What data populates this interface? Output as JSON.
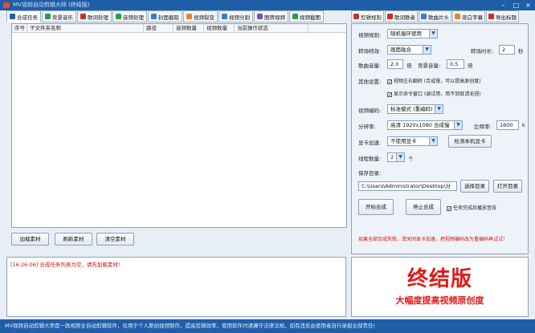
{
  "window": {
    "title": "MV视频自动剪辑大师 (终结版)"
  },
  "toolbar": {
    "tabs": [
      {
        "label": "合成任务",
        "icon": "play-icon",
        "color": "#1f5fa8"
      },
      {
        "label": "背景音乐",
        "icon": "music-icon",
        "color": "#2e9b4a"
      },
      {
        "label": "歌词处理",
        "icon": "lyrics-icon",
        "color": "#c8302a"
      },
      {
        "label": "音频处理",
        "icon": "audio-icon",
        "color": "#2e9b4a"
      },
      {
        "label": "封面截取",
        "icon": "cover-icon",
        "color": "#3a7bd5"
      },
      {
        "label": "视频裂变",
        "icon": "video-icon",
        "color": "#e08a1e"
      },
      {
        "label": "视频分割",
        "icon": "split-icon",
        "color": "#3a7bd5"
      },
      {
        "label": "图转视频",
        "icon": "image-icon",
        "color": "#7a4fc4"
      },
      {
        "label": "视频截图",
        "icon": "screenshot-icon",
        "color": "#2e9b4a"
      }
    ]
  },
  "table": {
    "columns": [
      "序号",
      "子文件夹名称",
      "路径",
      "音频数量",
      "视频数量",
      "当前操作状态"
    ]
  },
  "buttons": {
    "load": "加载素材",
    "refresh": "刷新素材",
    "clear": "清空素材"
  },
  "log": {
    "message": "[16:26:06] 合成任务列表为空，请先加载素材!"
  },
  "promo": {
    "title": "终结版",
    "subtitle": "大幅度提高视频原创度"
  },
  "right_tabs": [
    {
      "label": "剪辑规则",
      "icon": "rule-icon",
      "color": "#c8302a"
    },
    {
      "label": "歌词歌者",
      "icon": "lyrics-icon",
      "color": "#c8302a"
    },
    {
      "label": "歌曲片头",
      "icon": "intro-icon",
      "color": "#3a7bd5"
    },
    {
      "label": "旁白字幕",
      "icon": "subtitle-icon",
      "color": "#e08a1e"
    },
    {
      "label": "导出标题",
      "icon": "export-icon",
      "color": "#c8302a"
    }
  ],
  "settings": {
    "clip_rule_label": "视频规则:",
    "clip_rule_value": "随机循环使用",
    "transition_label": "转场特效:",
    "transition_value": "画面融合",
    "transition_duration_label": "转场时长:",
    "transition_duration_value": "2",
    "transition_duration_unit": "秒",
    "song_volume_label": "歌曲音量:",
    "song_volume_value": "2.0",
    "song_volume_unit": "倍",
    "bg_volume_label": "背景音量:",
    "bg_volume_value": "0.5",
    "bg_volume_unit": "倍",
    "other_label": "其他设置:",
    "mirror_option": "视频左右翻转 (合成慢，可以提高原创度)",
    "mirror_checked": true,
    "cmd_option": "显示命令窗口 (调试用，用不到就请无视)",
    "cmd_checked": true,
    "encoding_label": "视频编码:",
    "encoding_value": "标准模式 (重编码)",
    "resolution_label": "分辨率:",
    "resolution_value": "高清 1920x1080 合成慢",
    "bitrate_label": "比特率:",
    "bitrate_value": "1600",
    "bitrate_unit": "k",
    "gpu_label": "显卡加速:",
    "gpu_value": "不使用显卡",
    "gpu_check_button": "检测本机显卡",
    "threads_label": "线程数量:",
    "threads_value": "2",
    "threads_unit": "个",
    "save_dir_label": "保存目录:",
    "save_dir_value": "C:\\Users\\Administrator\\Desktop\\分",
    "choose_dir_button": "选择目录",
    "open_dir_button": "打开目录",
    "start_button": "开始合成",
    "stop_button": "停止合成",
    "play_sound_option": "任务完成后播放音效",
    "play_sound_checked": true,
    "warning": "如果全部合成失败，请关闭显卡加速，把视频编码改为重编码再试试！"
  },
  "status": {
    "text": "MV视频自动剪辑大师是一款视频全自动剪辑软件，仅用于个人原创视频制作，提高剪辑效率，使用软件时请遵守法律法规，如有违反由使用者自行承担全部责任!"
  }
}
